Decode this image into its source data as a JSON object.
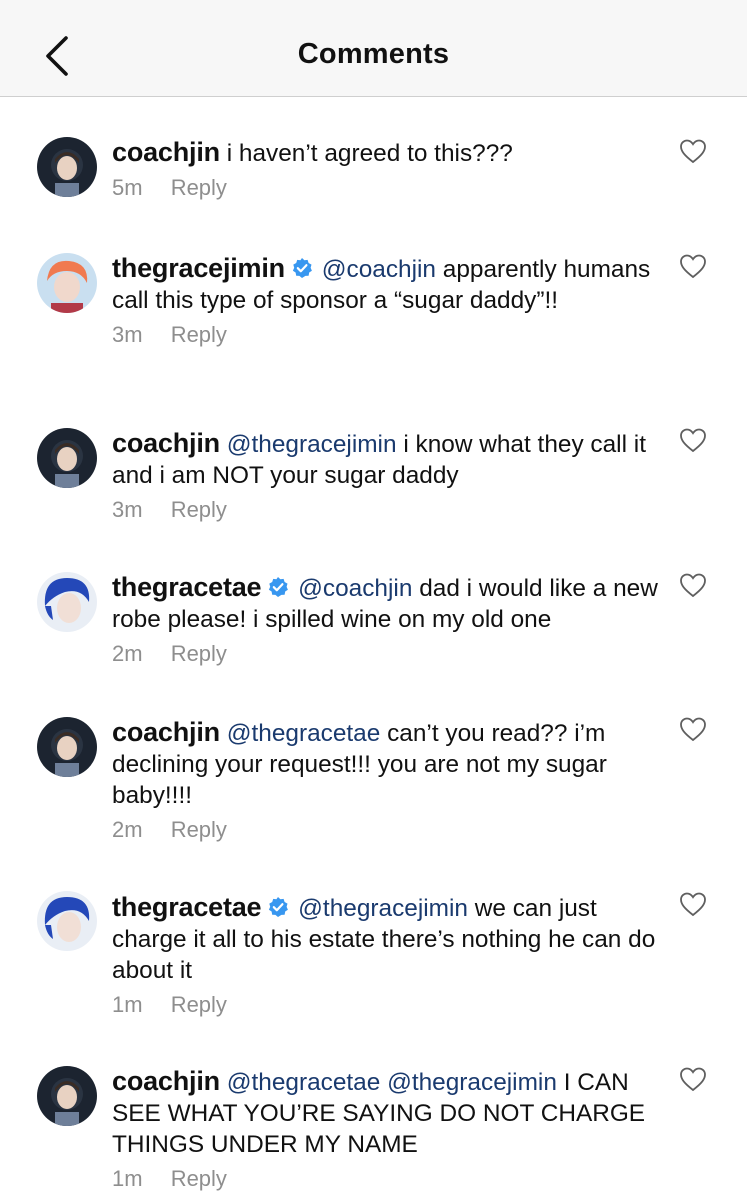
{
  "header": {
    "title": "Comments",
    "back_icon": "chevron-left-icon"
  },
  "colors": {
    "mention": "#1a3a6e",
    "meta": "#8e8e8e",
    "verified": "#3897f0",
    "header_bg": "#f7f7f7"
  },
  "comments": [
    {
      "username": "coachjin",
      "verified": false,
      "mentions": "",
      "text": "i haven’t agreed to this???",
      "time": "5m",
      "reply_label": "Reply"
    },
    {
      "username": "thegracejimin",
      "verified": true,
      "mentions": "@coachjin",
      "text": "apparently humans call this type of sponsor a “sugar daddy”!!",
      "time": "3m",
      "reply_label": "Reply"
    },
    {
      "username": "coachjin",
      "verified": false,
      "mentions": "@thegracejimin",
      "text": "i know what they call it and i am NOT your sugar daddy",
      "time": "3m",
      "reply_label": "Reply"
    },
    {
      "username": "thegracetae",
      "verified": true,
      "mentions": "@coachjin",
      "text": "dad i would like a new robe please! i spilled wine on my old one",
      "time": "2m",
      "reply_label": "Reply"
    },
    {
      "username": "coachjin",
      "verified": false,
      "mentions": "@thegracetae",
      "text": "can’t you read?? i’m declining your request!!! you are not my sugar baby!!!!",
      "time": "2m",
      "reply_label": "Reply"
    },
    {
      "username": "thegracetae",
      "verified": true,
      "mentions": "@thegracejimin",
      "text": "we can just charge it all to his estate there’s nothing he can do about it",
      "time": "1m",
      "reply_label": "Reply"
    },
    {
      "username": "coachjin",
      "verified": false,
      "mentions": "@thegracetae @thegracejimin",
      "text": "I CAN SEE WHAT YOU’RE SAYING DO NOT CHARGE THINGS UNDER MY NAME",
      "time": "1m",
      "reply_label": "Reply"
    }
  ]
}
